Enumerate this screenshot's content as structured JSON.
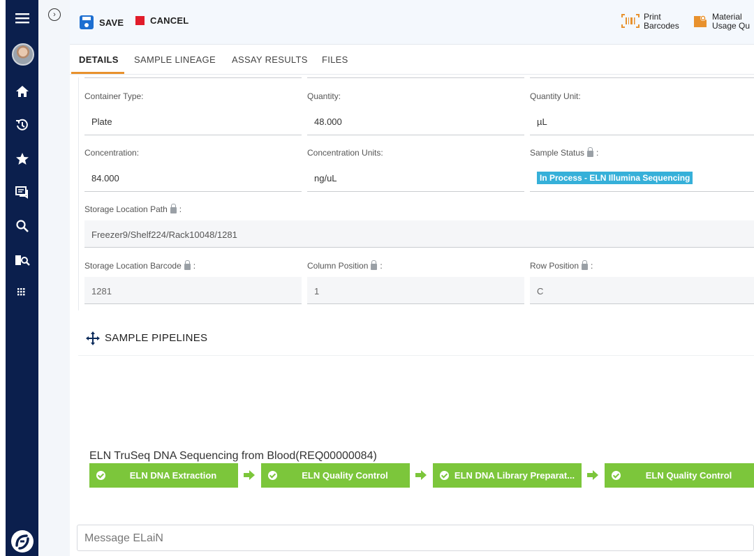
{
  "toolbar": {
    "save_label": "SAVE",
    "cancel_label": "CANCEL",
    "print_barcodes_line1": "Print",
    "print_barcodes_line2": "Barcodes",
    "material_usage_line1": "Material",
    "material_usage_line2": "Usage Qu"
  },
  "tabs": [
    {
      "label": "DETAILS",
      "active": true
    },
    {
      "label": "SAMPLE LINEAGE",
      "active": false
    },
    {
      "label": "ASSAY RESULTS",
      "active": false
    },
    {
      "label": "FILES",
      "active": false
    }
  ],
  "fields": {
    "container_type": {
      "label": "Container Type:",
      "value": "Plate"
    },
    "quantity": {
      "label": "Quantity:",
      "value": "48.000"
    },
    "quantity_unit": {
      "label": "Quantity Unit:",
      "value": "µL"
    },
    "concentration": {
      "label": "Concentration:",
      "value": "84.000"
    },
    "concentration_units": {
      "label": "Concentration Units:",
      "value": "ng/uL"
    },
    "sample_status": {
      "label": "Sample Status",
      "value": "In Process - ELN Illumina Sequencing"
    },
    "storage_location_path": {
      "label": "Storage Location Path",
      "value": "Freezer9/Shelf224/Rack10048/1281"
    },
    "storage_location_barcode": {
      "label": "Storage Location Barcode",
      "value": "1281"
    },
    "column_position": {
      "label": "Column Position",
      "value": "1"
    },
    "row_position": {
      "label": "Row Position",
      "value": "C"
    }
  },
  "colon": ":",
  "pipelines": {
    "title": "SAMPLE PIPELINES",
    "pipeline_name": "ELN TruSeq DNA Sequencing from Blood(REQ00000084)",
    "steps": [
      "ELN DNA Extraction",
      "ELN Quality Control",
      "ELN DNA Library Preparat...",
      "ELN Quality Control"
    ]
  },
  "message_placeholder": "Message ELaiN",
  "colors": {
    "nav_bg": "#0b1f4d",
    "accent_orange": "#e8912d",
    "step_green": "#7cc63b",
    "status_chip": "#36b0d9",
    "save_blue": "#1d6fd1",
    "cancel_red": "#e11c2a"
  },
  "icons": {
    "nav": [
      "menu-icon",
      "avatar",
      "home-icon",
      "history-icon",
      "star-icon",
      "chat-icon",
      "search-icon",
      "book-search-icon",
      "apps-grid-icon",
      "brand-logo-icon"
    ]
  }
}
